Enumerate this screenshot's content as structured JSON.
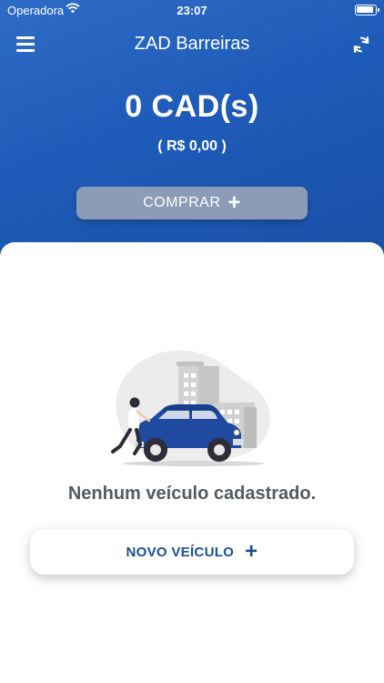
{
  "status_bar": {
    "carrier": "Operadora",
    "time": "23:07"
  },
  "header": {
    "title": "ZAD Barreiras"
  },
  "balance": {
    "cads": "0 CAD(s)",
    "money": "( R$ 0,00 )"
  },
  "buy_button": {
    "label": "COMPRAR",
    "plus": "+"
  },
  "empty_state": {
    "message": "Nenhum veículo cadastrado."
  },
  "new_vehicle_button": {
    "label": "NOVO VEÍCULO",
    "plus": "+"
  },
  "colors": {
    "primary": "#1e5bb8",
    "accent_text": "#1d4f93",
    "car": "#1f4aa0"
  }
}
